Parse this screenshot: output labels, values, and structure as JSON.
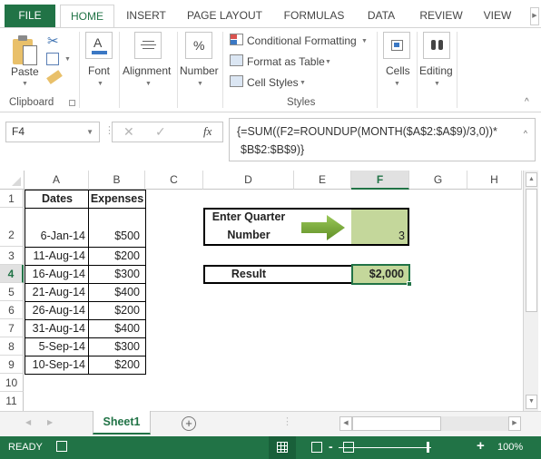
{
  "ribbon_tabs": [
    {
      "label": "FILE"
    },
    {
      "label": "HOME"
    },
    {
      "label": "INSERT"
    },
    {
      "label": "PAGE LAYOUT"
    },
    {
      "label": "FORMULAS"
    },
    {
      "label": "DATA"
    },
    {
      "label": "REVIEW"
    },
    {
      "label": "VIEW"
    }
  ],
  "ribbon": {
    "clipboard": {
      "paste": "Paste",
      "group": "Clipboard"
    },
    "font": "Font",
    "alignment": "Alignment",
    "number": "Number",
    "styles": {
      "conditional": "Conditional Formatting",
      "format_table": "Format as Table",
      "cell_styles": "Cell Styles",
      "group": "Styles"
    },
    "cells": "Cells",
    "editing": "Editing"
  },
  "formula_bar": {
    "name_box": "F4",
    "formula_line1": "{=SUM((F2=ROUNDUP(MONTH($A$2:$A$9)/3,0))*",
    "formula_line2": "$B$2:$B$9)}"
  },
  "columns": [
    "A",
    "B",
    "C",
    "D",
    "E",
    "F",
    "G",
    "H"
  ],
  "rows": [
    "1",
    "2",
    "3",
    "4",
    "5",
    "6",
    "7",
    "8",
    "9",
    "10",
    "11"
  ],
  "table": {
    "headers": [
      "Dates",
      "Expenses"
    ],
    "rows": [
      [
        "6-Jan-14",
        "$500"
      ],
      [
        "11-Aug-14",
        "$200"
      ],
      [
        "16-Aug-14",
        "$300"
      ],
      [
        "21-Aug-14",
        "$400"
      ],
      [
        "26-Aug-14",
        "$200"
      ],
      [
        "31-Aug-14",
        "$400"
      ],
      [
        "5-Sep-14",
        "$300"
      ],
      [
        "10-Sep-14",
        "$200"
      ]
    ]
  },
  "quarter_box": {
    "label_line1": "Enter Quarter",
    "label_line2": "Number",
    "value": "3"
  },
  "result_box": {
    "label": "Result",
    "value": "$2,000"
  },
  "colors": {
    "excel_green": "#217346",
    "input_fill": "#c4d79b",
    "arrow_green": "#77a532"
  },
  "sheet_tabs": [
    {
      "label": "Sheet1"
    }
  ],
  "status_bar": {
    "mode": "READY",
    "zoom": "100%",
    "zoom_level_percent": 100
  }
}
